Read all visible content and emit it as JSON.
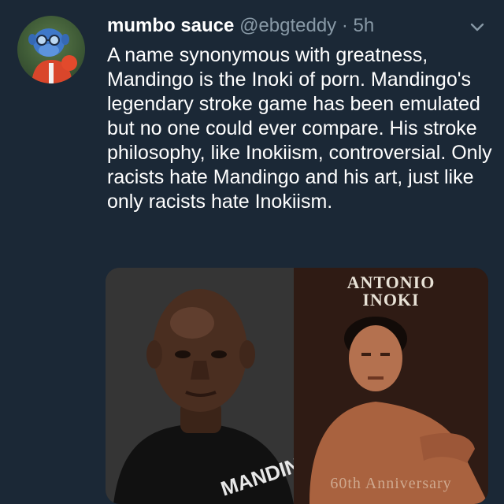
{
  "tweet": {
    "display_name": "mumbo sauce",
    "handle": "@ebgteddy",
    "separator": "·",
    "time": "5h",
    "text": "A name synonymous with greatness, Mandingo is the Inoki of porn. Mandingo's legendary stroke game has been emulated but no one could ever compare. His stroke philosophy, like Inokiism, controversial. Only racists hate Mandingo and his art, just like only racists hate Inokiism."
  },
  "media": {
    "right_poster_title_line1": "ANTONIO",
    "right_poster_title_line2": "INOKI",
    "right_poster_subtitle": "60th Anniversary",
    "left_shirt_text": "MANDINGO"
  },
  "icons": {
    "menu": "chevron-down-icon"
  },
  "colors": {
    "background": "#1b2836",
    "secondary_text": "#8899a6",
    "primary_text": "#ffffff"
  }
}
